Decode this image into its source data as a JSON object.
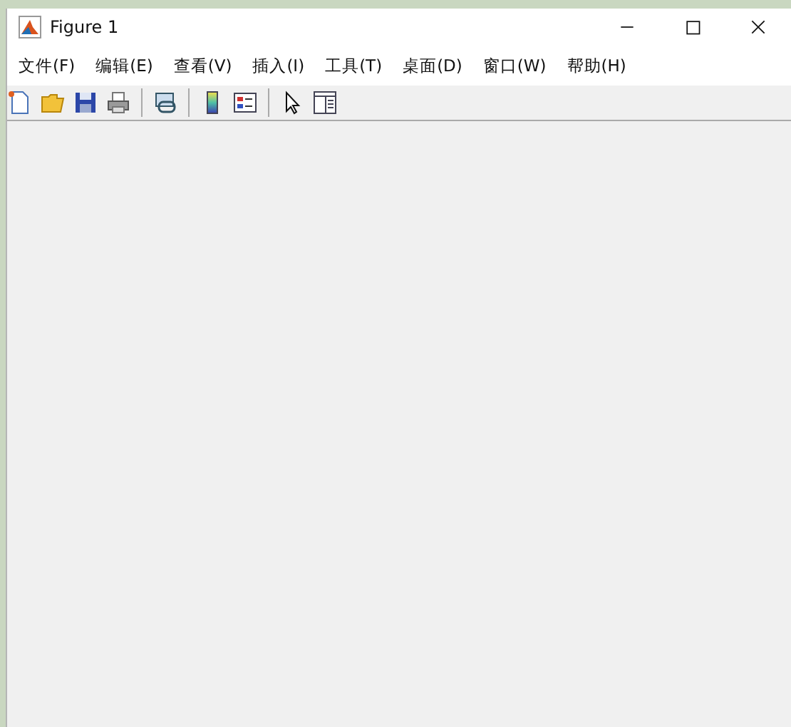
{
  "window": {
    "title": "Figure 1"
  },
  "menu": [
    {
      "label": "文件(F)"
    },
    {
      "label": "编辑(E)"
    },
    {
      "label": "查看(V)"
    },
    {
      "label": "插入(I)"
    },
    {
      "label": "工具(T)"
    },
    {
      "label": "桌面(D)"
    },
    {
      "label": "窗口(W)"
    },
    {
      "label": "帮助(H)"
    }
  ],
  "toolbar": [
    {
      "kind": "new"
    },
    {
      "kind": "open"
    },
    {
      "kind": "save"
    },
    {
      "kind": "print"
    },
    {
      "kind": "sep"
    },
    {
      "kind": "link"
    },
    {
      "kind": "sep"
    },
    {
      "kind": "colorbar"
    },
    {
      "kind": "legend"
    },
    {
      "kind": "sep"
    },
    {
      "kind": "pointer"
    },
    {
      "kind": "panel"
    }
  ]
}
